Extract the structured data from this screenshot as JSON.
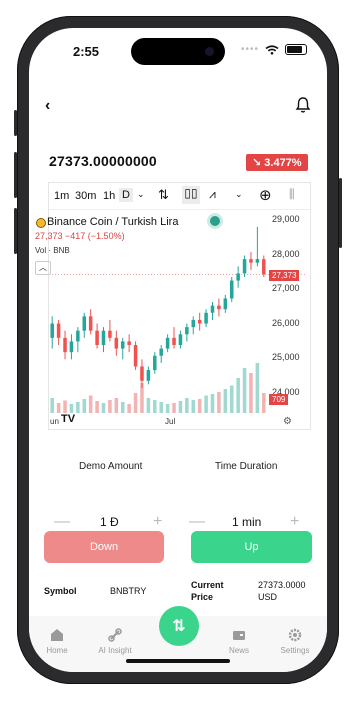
{
  "status": {
    "time": "2:55"
  },
  "header": {
    "price": "27373.00000000",
    "change": "3.477%",
    "change_arrow": "↘"
  },
  "chart": {
    "intervals": [
      "1m",
      "30m",
      "1h",
      "D"
    ],
    "selected_interval": "D",
    "title": "Binance Coin / Turkish Lira",
    "quote": "27,373 −417 (−1.50%)",
    "volume_label": "Vol · BNB",
    "y_ticks": [
      "29,000",
      "28,000",
      "27,000",
      "26,000",
      "25,000",
      "24,000"
    ],
    "price_tag": "27,373",
    "volume_tag": "709",
    "x_ticks": [
      "un",
      "Jul"
    ],
    "logo": "TV"
  },
  "chart_data": {
    "type": "candlestick",
    "title": "Binance Coin / Turkish Lira",
    "ylim": [
      23500,
      29200
    ],
    "y_ticks": [
      29000,
      28000,
      27000,
      26000,
      25000,
      24000
    ],
    "last_price": 27373,
    "last_volume": 709,
    "x_ticks": [
      "un",
      "Jul"
    ],
    "candles": [
      [
        25600,
        26200,
        25300,
        26000
      ],
      [
        26000,
        26100,
        25400,
        25600
      ],
      [
        25600,
        25800,
        25000,
        25200
      ],
      [
        25200,
        25700,
        25000,
        25500
      ],
      [
        25500,
        25900,
        25200,
        25800
      ],
      [
        25800,
        26300,
        25600,
        26200
      ],
      [
        26200,
        26400,
        25700,
        25800
      ],
      [
        25800,
        26000,
        25300,
        25400
      ],
      [
        25400,
        25900,
        25200,
        25800
      ],
      [
        25800,
        26100,
        25500,
        25600
      ],
      [
        25600,
        25800,
        25100,
        25300
      ],
      [
        25300,
        25600,
        25000,
        25500
      ],
      [
        25500,
        25700,
        25200,
        25400
      ],
      [
        25400,
        25500,
        24700,
        24800
      ],
      [
        24800,
        25000,
        24200,
        24400
      ],
      [
        24400,
        24800,
        24300,
        24700
      ],
      [
        24700,
        25200,
        24600,
        25100
      ],
      [
        25100,
        25400,
        24900,
        25300
      ],
      [
        25300,
        25700,
        25200,
        25600
      ],
      [
        25600,
        25900,
        25300,
        25400
      ],
      [
        25400,
        25800,
        25300,
        25700
      ],
      [
        25700,
        26000,
        25500,
        25900
      ],
      [
        25900,
        26200,
        25700,
        26100
      ],
      [
        26100,
        26300,
        25800,
        26000
      ],
      [
        26000,
        26400,
        25900,
        26300
      ],
      [
        26300,
        26600,
        26100,
        26500
      ],
      [
        26500,
        26700,
        26200,
        26400
      ],
      [
        26400,
        26800,
        26300,
        26700
      ],
      [
        26700,
        27300,
        26600,
        27200
      ],
      [
        27200,
        27600,
        27000,
        27400
      ],
      [
        27400,
        27900,
        27300,
        27800
      ],
      [
        27800,
        28000,
        27500,
        27700
      ],
      [
        27700,
        28700,
        27600,
        27800
      ],
      [
        27800,
        27900,
        27300,
        27373
      ]
    ],
    "volumes": [
      30,
      20,
      25,
      18,
      22,
      28,
      35,
      24,
      20,
      26,
      30,
      22,
      18,
      40,
      60,
      30,
      26,
      22,
      18,
      20,
      24,
      30,
      26,
      28,
      35,
      38,
      42,
      48,
      55,
      70,
      90,
      80,
      100,
      40
    ]
  },
  "trade": {
    "amount_label": "Demo Amount",
    "amount_value": "1 Đ",
    "duration_label": "Time Duration",
    "duration_value": "1 min",
    "minus": "—",
    "plus": "+",
    "down_label": "Down",
    "up_label": "Up"
  },
  "info": {
    "symbol_label": "Symbol",
    "symbol_value": "BNBTRY",
    "current_label_1": "Current",
    "current_label_2": "Price",
    "current_value_1": "27373.0000",
    "current_value_2": "USD"
  },
  "nav": {
    "items": [
      "Home",
      "AI Insight",
      "News",
      "Settings"
    ],
    "fab": "⇅"
  },
  "colors": {
    "up": "#26a69a",
    "down": "#ef5350",
    "accent": "#3ad48d"
  }
}
